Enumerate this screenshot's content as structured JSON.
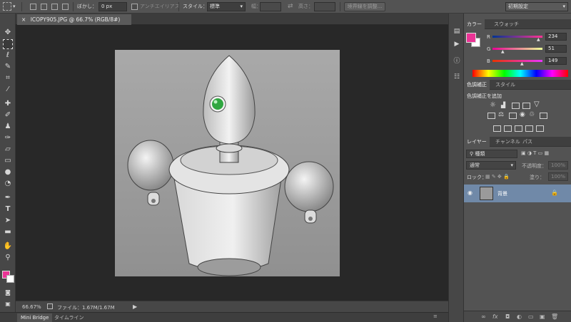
{
  "options_bar": {
    "feather_label": "ぼかし：",
    "feather_value": "0 px",
    "antialias_label": "アンチエイリアス",
    "style_label": "スタイル：",
    "style_value": "標準",
    "width_label": "幅：",
    "height_label": "高さ：",
    "refine_edge_label": "境界線を調整...",
    "workspace_value": "初期設定"
  },
  "document": {
    "tab_title": "ICOPY905.JPG @ 66.7% (RGB/8#)",
    "tab_close": "×"
  },
  "status": {
    "zoom": "66.67%",
    "file_info": "ファイル：1.67M/1.67M"
  },
  "bottom_tabs": [
    "Mini Bridge",
    "タイムライン"
  ],
  "color_panel": {
    "tabs": [
      "カラー",
      "スウォッチ"
    ],
    "r_label": "R",
    "g_label": "G",
    "b_label": "B",
    "r_value": "234",
    "g_value": "51",
    "b_value": "149",
    "foreground_color": "#ea3395",
    "background_color": "#ffffff"
  },
  "adjust_panel": {
    "tabs": [
      "色調補正",
      "スタイル"
    ],
    "title": "色調補正を追加"
  },
  "layers_panel": {
    "tabs": [
      "レイヤー",
      "チャンネル",
      "パス"
    ],
    "filter_value": "種類",
    "blend_mode": "通常",
    "opacity_label": "不透明度：",
    "opacity_value": "100%",
    "lock_label": "ロック：",
    "fill_label": "塗り：",
    "fill_value": "100%",
    "layer_name": "背景"
  }
}
